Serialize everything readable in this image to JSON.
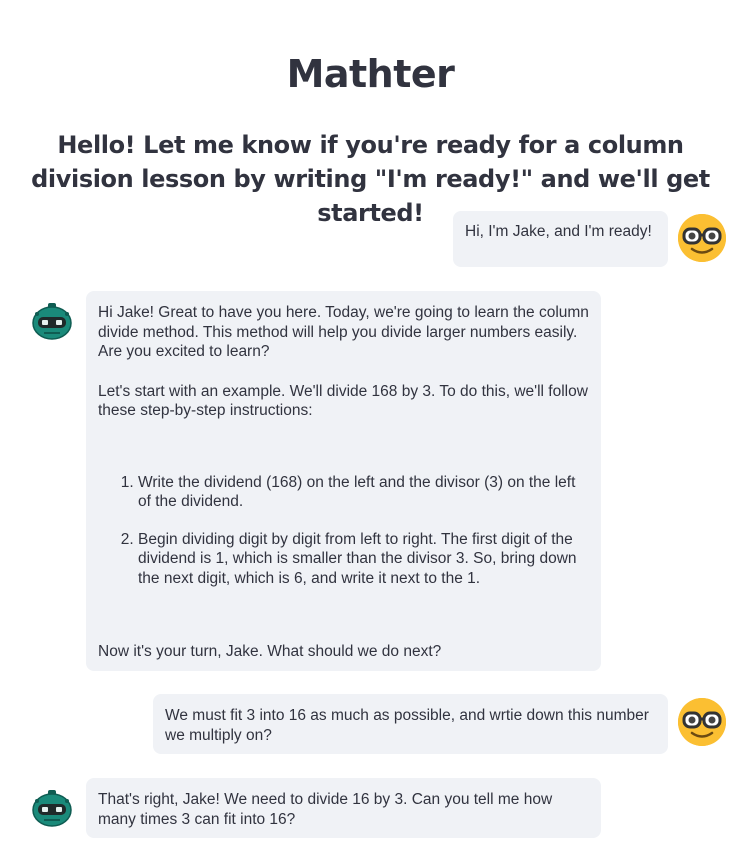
{
  "app": {
    "title": "Mathter",
    "intro": "Hello! Let me know if you're ready for a column division lesson by writing \"I'm ready!\" and we'll get started!"
  },
  "messages": {
    "m1": {
      "role": "user",
      "text": "Hi, I'm Jake, and I'm ready!"
    },
    "m2": {
      "role": "assistant",
      "p1": "Hi Jake! Great to have you here. Today, we're going to learn the column divide method. This method will help you divide larger numbers easily. Are you excited to learn?",
      "p2": "Let's start with an example. We'll divide 168 by 3. To do this, we'll follow these step-by-step instructions:",
      "steps": [
        "Write the dividend (168) on the left and the divisor (3) on the left of the dividend.",
        "Begin dividing digit by digit from left to right. The first digit of the dividend is 1, which is smaller than the divisor 3. So, bring down the next digit, which is 6, and write it next to the 1."
      ],
      "p3": "Now it's your turn, Jake. What should we do next?"
    },
    "m3": {
      "role": "user",
      "text": "We must fit 3 into 16 as much as possible, and wrtie down this number we multiply on?"
    },
    "m4": {
      "role": "assistant",
      "text": "That's right, Jake! We need to divide 16 by 3. Can you tell me how many times 3 can fit into 16?"
    }
  },
  "colors": {
    "bubble_bg": "#f0f2f6",
    "user_avatar": "#fbbf32",
    "bot_avatar": "#1a8a7a",
    "text": "#31333f"
  },
  "icons": {
    "user_avatar": "nerd-face-icon",
    "assistant_avatar": "robot-icon"
  }
}
